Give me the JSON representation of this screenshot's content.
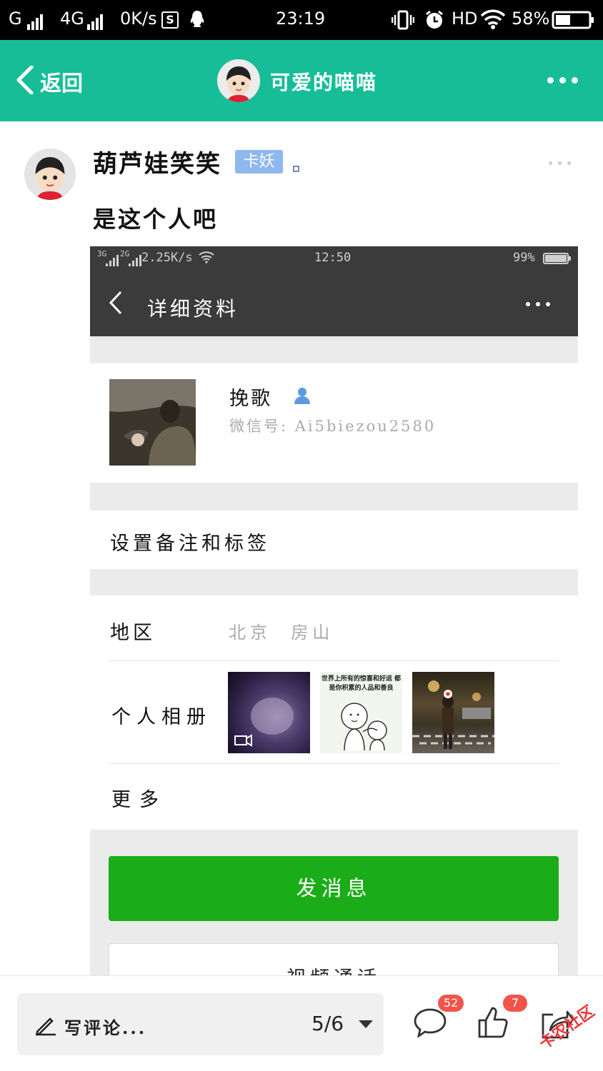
{
  "status_bar": {
    "network_1": "G",
    "network_2": "4G",
    "speed": "0K/s",
    "time": "23:19",
    "hd": "HD",
    "battery": "58%"
  },
  "header": {
    "back_label": "返回",
    "title": "可爱的喵喵"
  },
  "post": {
    "author": "葫芦娃笑笑",
    "badge": "卡妖",
    "text": "是这个人吧"
  },
  "screenshot": {
    "status": {
      "net_1": "3G",
      "net_2": "2G",
      "speed": "2.25K/s",
      "time": "12:50",
      "battery": "99%"
    },
    "title": "详细资料",
    "profile": {
      "name": "挽歌",
      "wechat_id": "微信号: Ai5biezou2580"
    },
    "remark_label": "设置备注和标签",
    "region_label": "地区",
    "region_value": "北京  房山",
    "album_label": "个人相册",
    "album_caption": "世界上所有的惊喜和好运 都是你积累的人品和善良",
    "more_label": "更多",
    "send_button": "发消息",
    "video_call_button": "视频通话"
  },
  "bottom_bar": {
    "comment_placeholder": "写评论...",
    "page_indicator": "5/6",
    "comments_count": "52",
    "likes_count": "7"
  },
  "watermark": "卡农社区",
  "colors": {
    "header_bg": "#17bd97",
    "badge_bg": "#8fb8ee",
    "send_button_bg": "#1aad19",
    "count_badge_bg": "#f0544a"
  }
}
